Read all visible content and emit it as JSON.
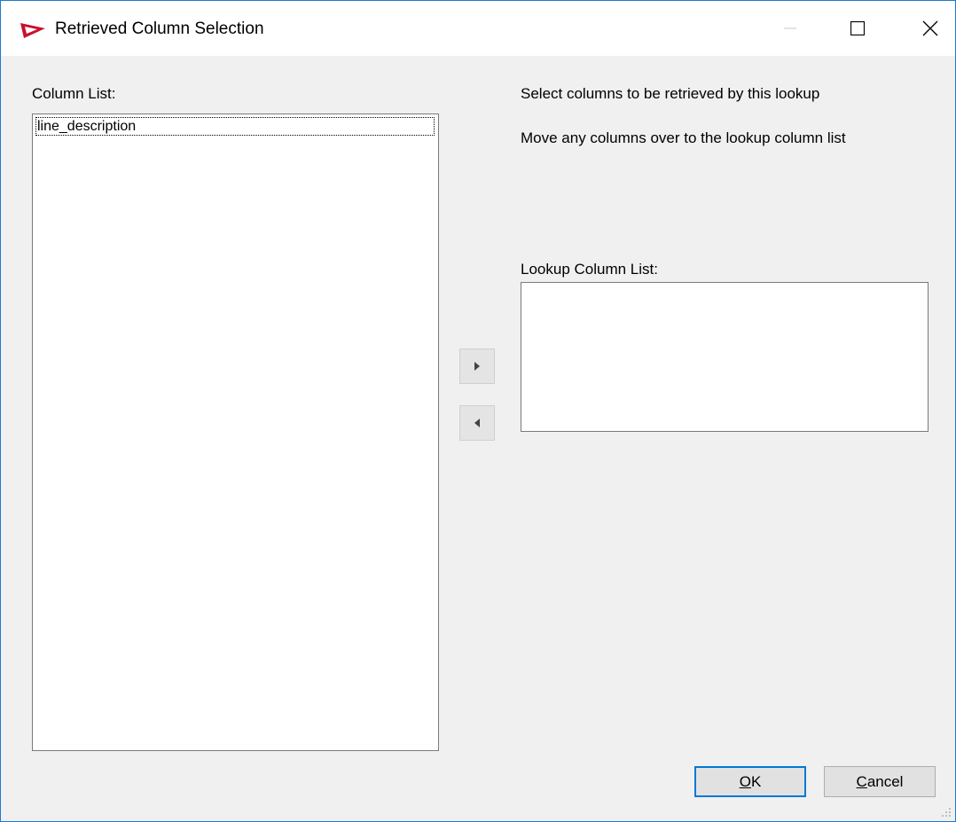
{
  "window": {
    "title": "Retrieved Column Selection",
    "icon": "wherescape-logo-icon",
    "controls": [
      "minimize-icon",
      "maximize-icon",
      "close-icon"
    ]
  },
  "left_panel": {
    "label": "Column List:",
    "items": [
      "line_description"
    ]
  },
  "right_panel": {
    "instruction_1": "Select columns to be retrieved by this lookup",
    "instruction_2": "Move any columns over to the lookup column list",
    "lookup_label": "Lookup Column List:",
    "lookup_items": []
  },
  "transfer": {
    "add_icon": "triangle-right-icon",
    "remove_icon": "triangle-left-icon"
  },
  "buttons": {
    "ok_mnemonic": "O",
    "ok_rest": "K",
    "cancel_mnemonic": "C",
    "cancel_rest": "ancel"
  },
  "colors": {
    "accent": "#0078d7",
    "window_border": "#1f78d1",
    "logo_red": "#c8102e"
  }
}
